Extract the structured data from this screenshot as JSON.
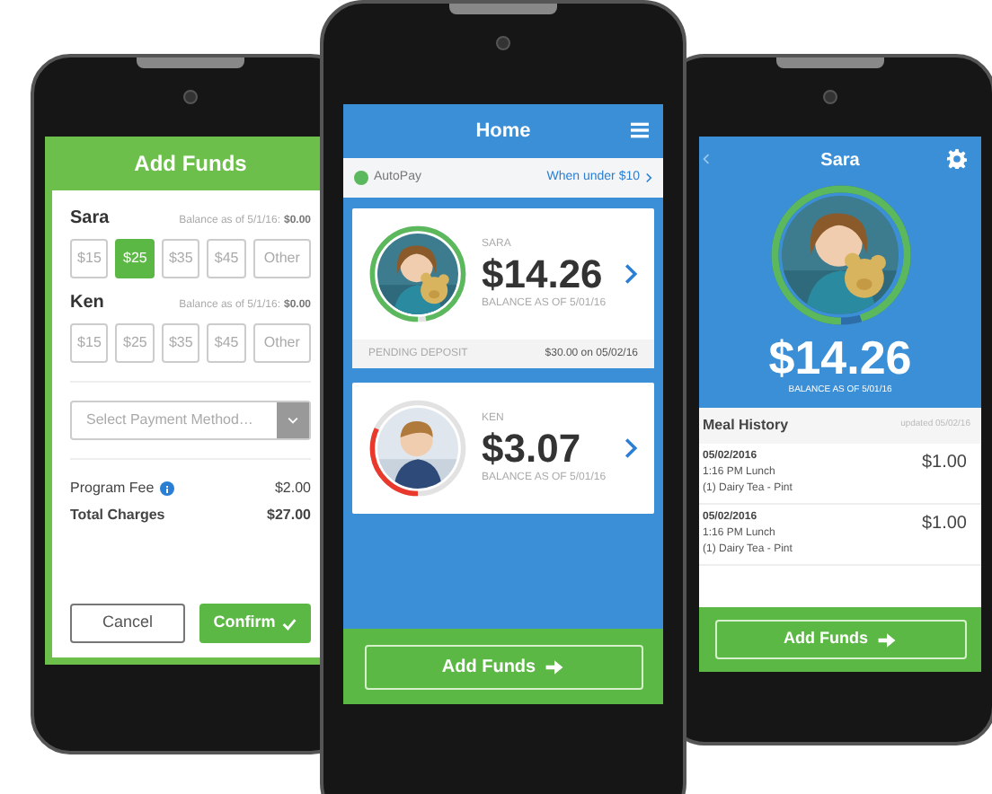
{
  "phones": [
    {
      "kind": "add_funds",
      "title": "Add Funds",
      "children": [
        {
          "name": "Sara",
          "balance_label": "Balance as of 5/1/16:",
          "balance": "$0.00",
          "amounts": [
            {
              "label": "$15",
              "selected": false
            },
            {
              "label": "$25",
              "selected": true
            },
            {
              "label": "$35",
              "selected": false
            },
            {
              "label": "$45",
              "selected": false
            },
            {
              "label": "Other",
              "selected": false
            }
          ]
        },
        {
          "name": "Ken",
          "balance_label": "Balance as of 5/1/16:",
          "balance": "$0.00",
          "amounts": [
            {
              "label": "$15",
              "selected": false
            },
            {
              "label": "$25",
              "selected": false
            },
            {
              "label": "$35",
              "selected": false
            },
            {
              "label": "$45",
              "selected": false
            },
            {
              "label": "Other",
              "selected": false
            }
          ]
        }
      ],
      "payment": {
        "placeholder": "Select Payment Method…"
      },
      "fees": [
        {
          "kind": "fee",
          "label": "Program Fee",
          "value": "$2.00"
        },
        {
          "kind": "total",
          "label": "Total Charges",
          "value": "$27.00"
        }
      ],
      "cancel": "Cancel",
      "confirm": "Confirm"
    },
    {
      "kind": "home",
      "title": "Home",
      "autopay": {
        "on": true,
        "label": "AutoPay",
        "link": "When under $10"
      },
      "cards": [
        {
          "name": "SARA",
          "amount": "$14.26",
          "balance_label": "BALANCE AS OF 5/01/16",
          "level": 0.97,
          "color": "#5cb85c",
          "pending": {
            "label": "PENDING DEPOSIT",
            "value": "$30.00 on 05/02/16"
          }
        },
        {
          "name": "KEN",
          "amount": "$3.07",
          "balance_label": "BALANCE AS OF 5/01/16",
          "level": 0.32,
          "color": "#e8392c"
        }
      ],
      "button": "Add Funds"
    },
    {
      "kind": "detail",
      "title": "Sara",
      "amount": "$14.26",
      "balance_label": "BALANCE AS OF 5/01/16",
      "level": 0.95,
      "history": {
        "title": "Meal History",
        "updated": "updated 05/02/16",
        "entries": [
          {
            "date": "05/02/2016",
            "time": "1:16 PM Lunch",
            "item": "(1) Dairy Tea - Pint",
            "price": "$1.00"
          },
          {
            "date": "05/02/2016",
            "time": "1:16 PM Lunch",
            "item": "(1) Dairy Tea - Pint",
            "price": "$1.00"
          }
        ]
      },
      "button": "Add Funds"
    }
  ]
}
